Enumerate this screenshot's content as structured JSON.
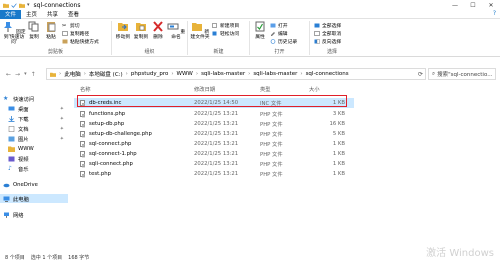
{
  "window": {
    "title": "sql-connections",
    "controls": [
      "—",
      "☐",
      "✕"
    ]
  },
  "ribbon_tabs": [
    "文件",
    "主页",
    "共享",
    "查看"
  ],
  "ribbon": {
    "clipboard": {
      "pin_label": "固定到'快速访问'",
      "copy_label": "复制",
      "paste_label": "粘贴",
      "cut_label": "剪切",
      "copy_path_label": "复制路径",
      "paste_shortcut_label": "粘贴快捷方式",
      "group_label": "剪贴板"
    },
    "organize": {
      "move_to_label": "移动到",
      "copy_to_label": "复制到",
      "delete_label": "删除",
      "rename_label": "重命名",
      "group_label": "组织"
    },
    "new": {
      "new_folder_label": "新建文件夹",
      "new_item_label": "新建项目",
      "easy_access_label": "轻松访问",
      "group_label": "新建"
    },
    "open": {
      "properties_label": "属性",
      "open_label": "打开",
      "edit_label": "编辑",
      "history_label": "历史记录",
      "group_label": "打开"
    },
    "select": {
      "select_all_label": "全部选择",
      "select_none_label": "全部取消",
      "invert_label": "反向选择",
      "group_label": "选择"
    }
  },
  "address": {
    "crumbs": [
      "此电脑",
      "本地磁盘 (C:)",
      "phpstudy_pro",
      "WWW",
      "sqli-labs-master",
      "sqli-labs-master",
      "sql-connections"
    ],
    "search_placeholder": "搜索\"sql-connectio..."
  },
  "sidebar": {
    "items": [
      {
        "label": "快速访问",
        "icon": "star-icon"
      },
      {
        "label": "桌面",
        "icon": "desktop-icon"
      },
      {
        "label": "下载",
        "icon": "download-icon"
      },
      {
        "label": "文档",
        "icon": "document-icon"
      },
      {
        "label": "图片",
        "icon": "picture-icon"
      },
      {
        "label": "WWW",
        "icon": "folder-icon"
      },
      {
        "label": "视频",
        "icon": "video-icon"
      },
      {
        "label": "音乐",
        "icon": "music-icon"
      },
      {
        "label": "OneDrive",
        "icon": "cloud-icon"
      },
      {
        "label": "此电脑",
        "icon": "computer-icon"
      },
      {
        "label": "网络",
        "icon": "network-icon"
      }
    ]
  },
  "file_list": {
    "columns": [
      "名称",
      "修改日期",
      "类型",
      "大小"
    ],
    "rows": [
      {
        "name": "db-creds.inc",
        "date": "2022/1/25 14:50",
        "type": "INC 文件",
        "size": "1 KB"
      },
      {
        "name": "functions.php",
        "date": "2022/1/25 13:21",
        "type": "PHP 文件",
        "size": "3 KB"
      },
      {
        "name": "setup-db.php",
        "date": "2022/1/25 13:21",
        "type": "PHP 文件",
        "size": "16 KB"
      },
      {
        "name": "setup-db-challenge.php",
        "date": "2022/1/25 13:21",
        "type": "PHP 文件",
        "size": "5 KB"
      },
      {
        "name": "sql-connect.php",
        "date": "2022/1/25 13:21",
        "type": "PHP 文件",
        "size": "1 KB"
      },
      {
        "name": "sql-connect-1.php",
        "date": "2022/1/25 13:21",
        "type": "PHP 文件",
        "size": "1 KB"
      },
      {
        "name": "sqli-connect.php",
        "date": "2022/1/25 13:21",
        "type": "PHP 文件",
        "size": "1 KB"
      },
      {
        "name": "test.php",
        "date": "2022/1/25 13:21",
        "type": "PHP 文件",
        "size": "1 KB"
      }
    ]
  },
  "status": {
    "count": "8 个项目",
    "selected": "选中 1 个项目",
    "size": "168 字节"
  },
  "watermark": "激活 Windows",
  "colors": {
    "accent": "#1979ca",
    "selection": "#cce8ff",
    "highlight_border": "#e0202a"
  }
}
